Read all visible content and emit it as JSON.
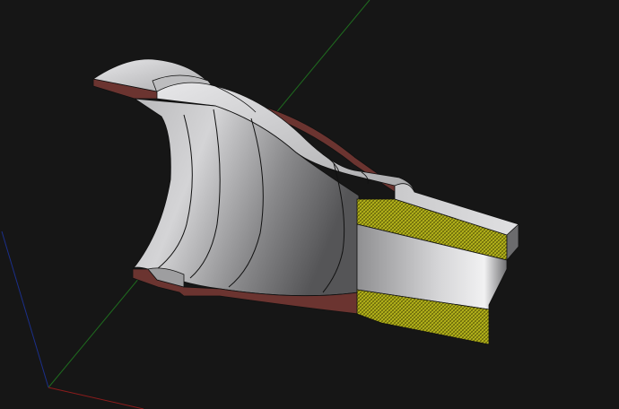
{
  "viewport": {
    "background": "#161616",
    "colors": {
      "x_axis": "#8b1c1c",
      "y_axis": "#1f6b1f",
      "z_axis": "#1b2f8a",
      "body_light": "#c9c9cb",
      "body_dark": "#4a4a4c",
      "cut_face": "#6b3430",
      "hatch_fill": "#b9b81c",
      "hatch_line": "#5b5a06",
      "edge": "#111111"
    },
    "icons": [
      "x-axis-line",
      "y-axis-line",
      "z-axis-line"
    ]
  }
}
